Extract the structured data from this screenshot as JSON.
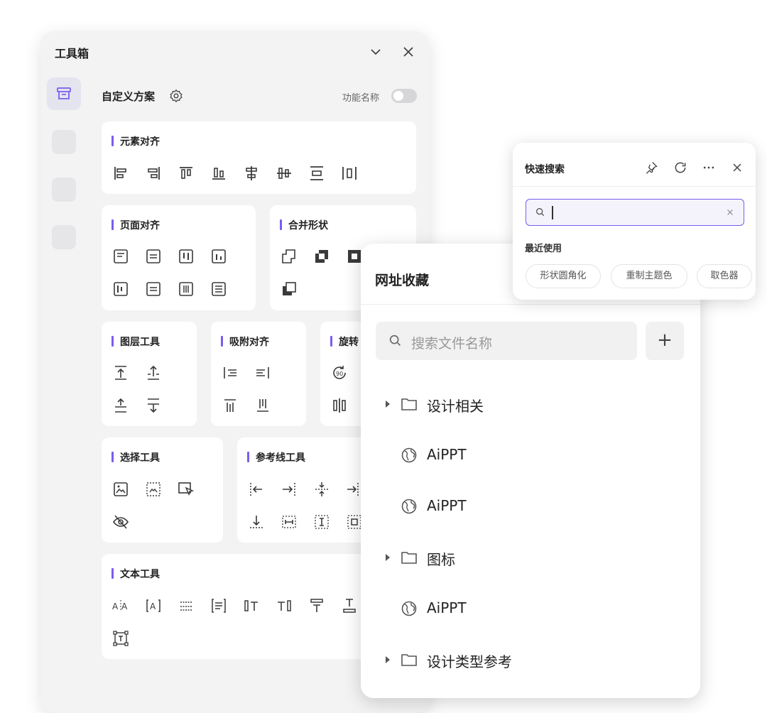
{
  "toolbox": {
    "title": "工具箱",
    "scheme_title": "自定义方案",
    "function_name_label": "功能名称",
    "function_name_toggle": false,
    "sections": {
      "element_align": "元素对齐",
      "page_align": "页面对齐",
      "merge_shapes": "合并形状",
      "layer_tools": "图层工具",
      "snap_align": "吸附对齐",
      "rotate": "旋转",
      "select_tools": "选择工具",
      "guide_tools": "参考线工具",
      "text_tools": "文本工具"
    }
  },
  "bookmarks": {
    "title": "网址收藏",
    "search_placeholder": "搜索文件名称",
    "add_label": "+",
    "items": [
      {
        "type": "folder",
        "label": "设计相关"
      },
      {
        "type": "link",
        "label": "AiPPT"
      },
      {
        "type": "link",
        "label": "AiPPT"
      },
      {
        "type": "folder",
        "label": "图标"
      },
      {
        "type": "link",
        "label": "AiPPT"
      },
      {
        "type": "folder",
        "label": "设计类型参考"
      }
    ]
  },
  "quick_search": {
    "title": "快速搜索",
    "input_value": "",
    "recent_label": "最近使用",
    "chips": [
      "形状圆角化",
      "重制主题色",
      "取色器"
    ]
  },
  "colors": {
    "accent": "#7b5cf0",
    "panel_bg": "#f3f3f4",
    "card_bg": "#ffffff"
  }
}
